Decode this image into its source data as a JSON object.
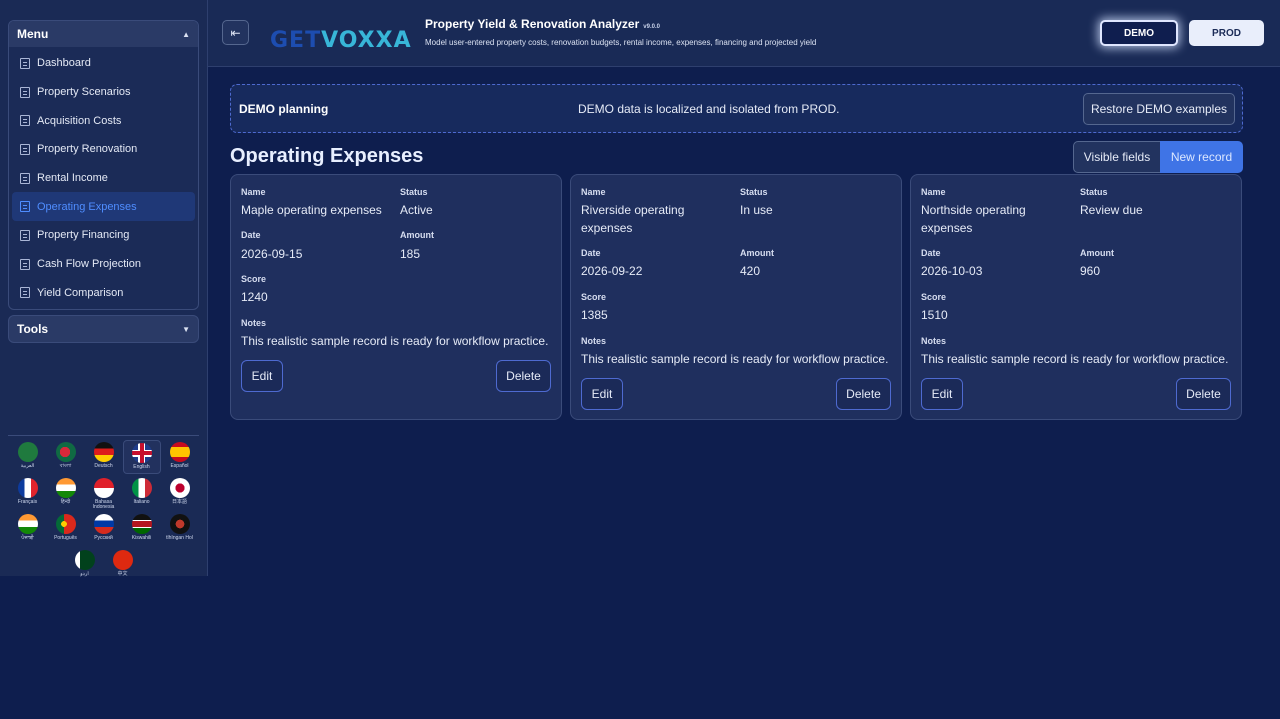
{
  "sidebar": {
    "menu_title": "Menu",
    "items": [
      {
        "label": "Dashboard"
      },
      {
        "label": "Property Scenarios"
      },
      {
        "label": "Acquisition Costs"
      },
      {
        "label": "Property Renovation"
      },
      {
        "label": "Rental Income"
      },
      {
        "label": "Operating Expenses"
      },
      {
        "label": "Property Financing"
      },
      {
        "label": "Cash Flow Projection"
      },
      {
        "label": "Yield Comparison"
      }
    ],
    "active_item": "Operating Expenses",
    "tools_title": "Tools",
    "languages": [
      {
        "label": "العربية",
        "flag": "saudi-arabia"
      },
      {
        "label": "বাংলা",
        "flag": "bangladesh"
      },
      {
        "label": "Deutsch",
        "flag": "germany"
      },
      {
        "label": "English",
        "flag": "united-kingdom"
      },
      {
        "label": "Español",
        "flag": "spain"
      },
      {
        "label": "Français",
        "flag": "france"
      },
      {
        "label": "हिन्दी",
        "flag": "india"
      },
      {
        "label": "Bahasa Indonesia",
        "flag": "indonesia"
      },
      {
        "label": "Italiano",
        "flag": "italy"
      },
      {
        "label": "日本語",
        "flag": "japan"
      },
      {
        "label": "ਪੰਜਾਬੀ",
        "flag": "india"
      },
      {
        "label": "Português",
        "flag": "portugal"
      },
      {
        "label": "Русский",
        "flag": "russia"
      },
      {
        "label": "Kiswahili",
        "flag": "kenya"
      },
      {
        "label": "tlhIngan Hol",
        "flag": "klingon"
      },
      {
        "label": "اردو",
        "flag": "pakistan"
      },
      {
        "label": "中文",
        "flag": "china"
      }
    ],
    "selected_language": "English"
  },
  "header": {
    "logo_text_a": "GET",
    "logo_text_b": "VOXXA",
    "title": "Property Yield & Renovation Analyzer",
    "version": "v9.0.0",
    "subtitle": "Model user-entered property costs, renovation budgets, rental income, expenses, financing and projected yield",
    "demo_label": "DEMO",
    "prod_label": "PROD"
  },
  "banner": {
    "title": "DEMO planning",
    "message": "DEMO data is localized and isolated from PROD.",
    "restore_label": "Restore DEMO examples"
  },
  "section": {
    "title": "Operating Expenses",
    "visible_fields_label": "Visible fields",
    "new_record_label": "New record"
  },
  "labels": {
    "name": "Name",
    "status": "Status",
    "date": "Date",
    "amount": "Amount",
    "score": "Score",
    "notes": "Notes",
    "edit": "Edit",
    "delete": "Delete"
  },
  "records": [
    {
      "name": "Maple operating expenses",
      "status": "Active",
      "date": "2026-09-15",
      "amount": "185",
      "score": "1240",
      "notes": "This realistic sample record is ready for workflow practice."
    },
    {
      "name": "Riverside operating expenses",
      "status": "In use",
      "date": "2026-09-22",
      "amount": "420",
      "score": "1385",
      "notes": "This realistic sample record is ready for workflow practice."
    },
    {
      "name": "Northside operating expenses",
      "status": "Review due",
      "date": "2026-10-03",
      "amount": "960",
      "score": "1510",
      "notes": "This realistic sample record is ready for workflow practice."
    }
  ],
  "colors": {
    "background": "#0e1e4e",
    "accent": "#3f74e6",
    "active_nav": "#4f8dff"
  }
}
